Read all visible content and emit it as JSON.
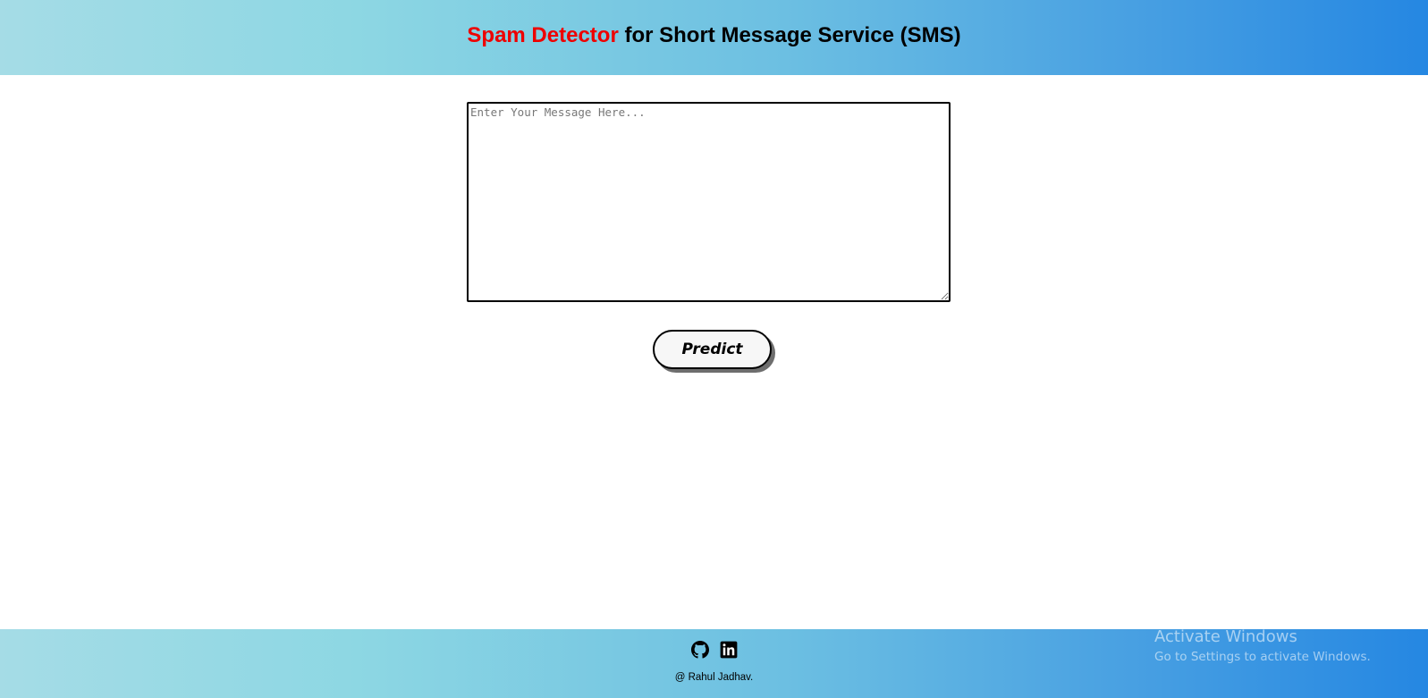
{
  "header": {
    "title_accent": "Spam Detector",
    "title_rest": " for Short Message Service (SMS)",
    "accent_color": "#ee0000"
  },
  "form": {
    "message_placeholder": "Enter Your Message Here...",
    "message_value": "",
    "predict_label": "Predict"
  },
  "footer": {
    "icons": [
      "github-icon",
      "linkedin-icon"
    ],
    "credit": "@ Rahul Jadhav."
  },
  "watermark": {
    "title": "Activate Windows",
    "subtitle": "Go to Settings to activate Windows."
  }
}
